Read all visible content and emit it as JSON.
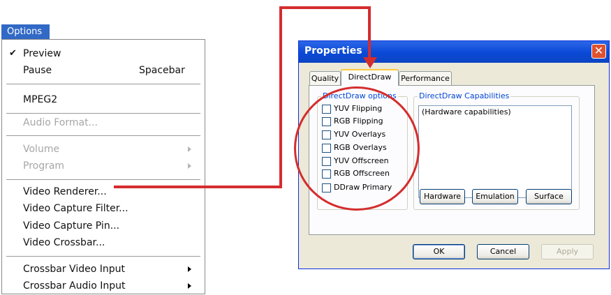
{
  "menu": {
    "title": "Options",
    "items": [
      {
        "label": "Preview",
        "checked": true
      },
      {
        "label": "Pause",
        "shortcut": "Spacebar"
      },
      {
        "label": "MPEG2"
      },
      {
        "label": "Audio Format...",
        "disabled": true
      },
      {
        "label": "Volume",
        "disabled": true,
        "submenu": true
      },
      {
        "label": "Program",
        "disabled": true,
        "submenu": true
      },
      {
        "label": "Video Renderer..."
      },
      {
        "label": "Video Capture Filter..."
      },
      {
        "label": "Video Capture Pin..."
      },
      {
        "label": "Video Crossbar..."
      },
      {
        "label": "Crossbar Video Input",
        "submenu": true
      },
      {
        "label": "Crossbar Audio Input",
        "submenu": true
      }
    ]
  },
  "dialog": {
    "title": "Properties",
    "close_glyph": "✕",
    "tabs": [
      {
        "label": "Quality"
      },
      {
        "label": "DirectDraw",
        "selected": true
      },
      {
        "label": "Performance"
      }
    ],
    "options_group": {
      "title": "DirectDraw options",
      "items": [
        "YUV Flipping",
        "RGB Flipping",
        "YUV Overlays",
        "RGB Overlays",
        "YUV Offscreen",
        "RGB Offscreen",
        "DDraw Primary"
      ]
    },
    "capabilities_group": {
      "title": "DirectDraw Capabilities",
      "list_text": "(Hardware capabilities)",
      "buttons": [
        "Hardware",
        "Emulation",
        "Surface"
      ]
    },
    "footer": {
      "ok": "OK",
      "cancel": "Cancel",
      "apply": "Apply"
    }
  },
  "colors": {
    "annotation": "#d42d2d",
    "menu_highlight": "#3169c6",
    "titlebar": "#0a49d6"
  }
}
